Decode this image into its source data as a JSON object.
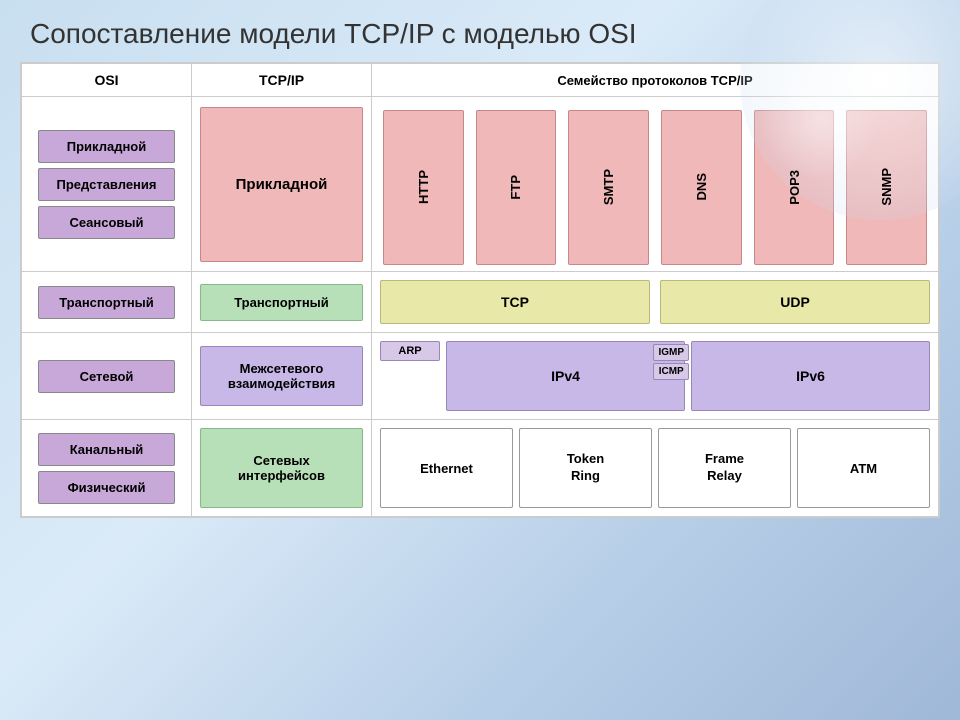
{
  "title": "Сопоставление модели TCP/IP с моделью OSI",
  "columns": {
    "osi": "OSI",
    "tcpip": "TCP/IP",
    "protocols": "Семейство протоколов TCP/IP"
  },
  "osi_layers": {
    "application": "Прикладной",
    "presentation": "Представления",
    "session": "Сеансовый",
    "transport": "Транспортный",
    "network": "Сетевой",
    "datalink": "Канальный",
    "physical": "Физический"
  },
  "tcpip_layers": {
    "application": "Прикладной",
    "transport": "Транспортный",
    "internet": "Межсетевого взаимодействия",
    "network": "Сетевых интерфейсов"
  },
  "app_protocols": [
    "HTTP",
    "FTP",
    "SMTP",
    "DNS",
    "POP3",
    "SNMP"
  ],
  "transport_protocols": [
    "TCP",
    "UDP"
  ],
  "internet_protocols": {
    "main": [
      "IPv4",
      "IPv6"
    ],
    "small": [
      "ARP",
      "IGMP",
      "ICMP"
    ]
  },
  "network_protocols": [
    "Ethernet",
    "Token Ring",
    "Frame Relay",
    "ATM"
  ]
}
